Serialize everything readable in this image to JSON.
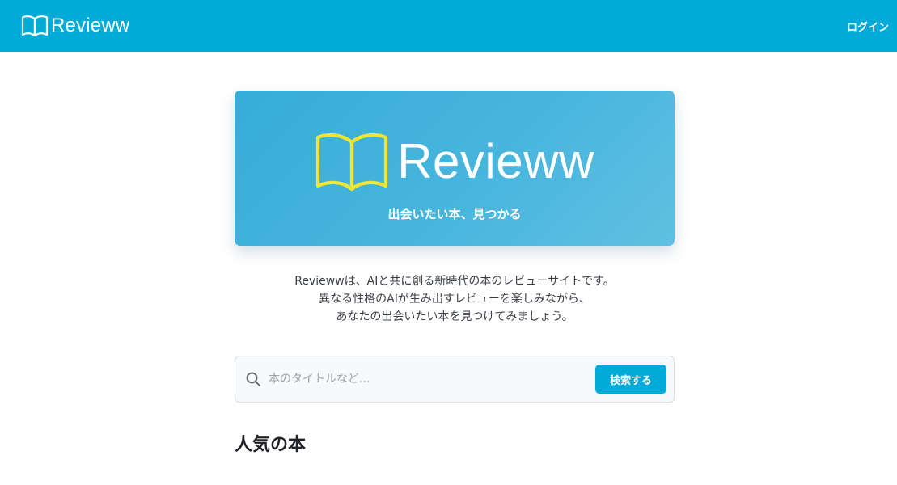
{
  "header": {
    "brand_name": "Revieww",
    "login_label": "ログイン"
  },
  "hero": {
    "brand_name": "Revieww",
    "tagline": "出会いたい本、見つかる"
  },
  "intro": {
    "lines": [
      "Reviewwは、AIと共に創る新時代の本のレビューサイトです。",
      "異なる性格のAIが生み出すレビューを楽しみながら、",
      "あなたの出会いたい本を見つけてみましょう。"
    ]
  },
  "search": {
    "placeholder": "本のタイトルなど...",
    "value": "",
    "button_label": "検索する"
  },
  "popular": {
    "title": "人気の本"
  },
  "icons": {
    "header_logo": "open-book-icon",
    "hero_logo": "open-book-icon",
    "search": "search-icon"
  },
  "colors": {
    "brand": "#00abd8",
    "hero_logo_icon": "#f0e530",
    "text": "#3a3f47"
  }
}
